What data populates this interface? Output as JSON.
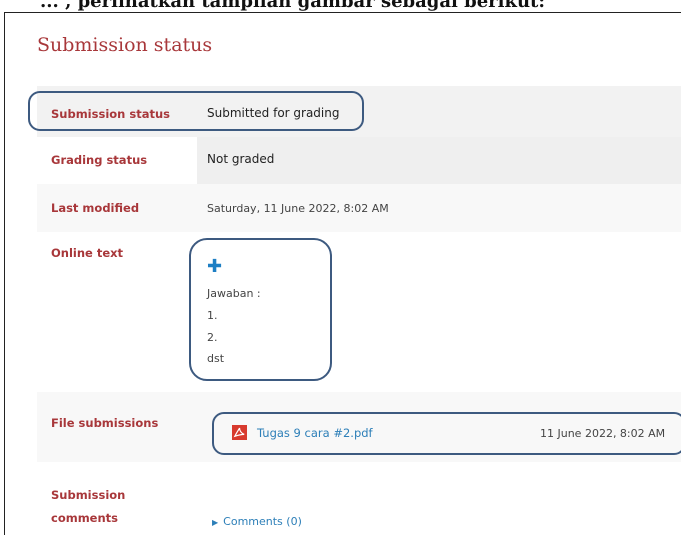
{
  "top_text": "... , perlihatkan tampilan gambar sebagai berikut:",
  "heading": "Submission status",
  "rows": [
    {
      "label": "Submission status",
      "value": "Submitted for grading"
    },
    {
      "label": "Grading status",
      "value": "Not graded"
    },
    {
      "label": "Last modified",
      "value": "Saturday, 11 June 2022, 8:02 AM"
    },
    {
      "label": "Online text"
    },
    {
      "label": "File submissions"
    },
    {
      "label_line1": "Submission",
      "label_line2": "comments"
    }
  ],
  "online_text": {
    "lines": [
      "Jawaban :",
      "1.",
      "2.",
      "dst"
    ]
  },
  "file": {
    "name": "Tugas 9 cara #2.pdf",
    "date": "11 June 2022, 8:02 AM"
  },
  "comments_link": "Comments (0)",
  "colors": {
    "label": "#a8373a",
    "link": "#2d7fb8",
    "callout": "#3d5a80"
  }
}
